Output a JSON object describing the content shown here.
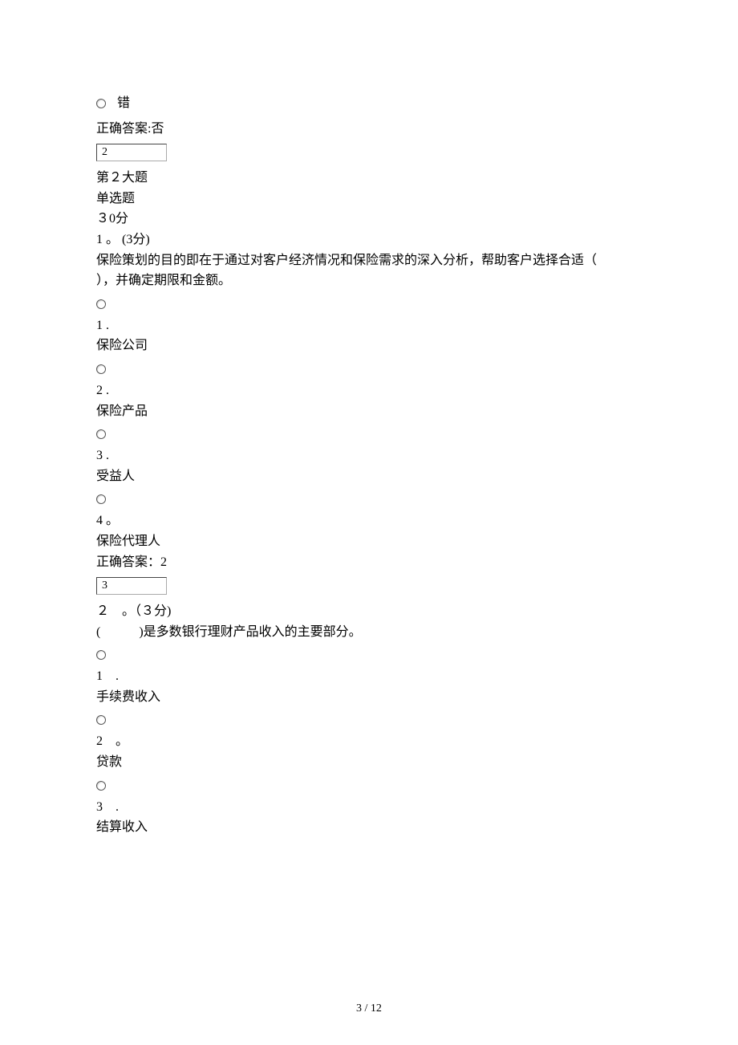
{
  "topRadio": {
    "label": "错"
  },
  "topAnswer": "正确答案:否",
  "box1": "2",
  "section2": {
    "header": {
      "l1": "第２大题",
      "l2": "单选题",
      "l3": "３0分"
    },
    "q1": {
      "lead": "1 。 (3分)",
      "text1": "保险策划的目的即在于通过对客户经济情况和保险需求的深入分析，帮助客户选择合适（",
      "text2": "），并确定期限和金额。",
      "opts": [
        {
          "num": "1 .",
          "text": "保险公司"
        },
        {
          "num": "2 .",
          "text": "保险产品"
        },
        {
          "num": "3 .",
          "text": "受益人"
        },
        {
          "num": "4 。",
          "text": "保险代理人"
        }
      ],
      "answer": "正确答案：2"
    },
    "box2": "3",
    "q2": {
      "lead": "２　。（３分)",
      "text1": "(　　　)是多数银行理财产品收入的主要部分。",
      "opts": [
        {
          "num": "1　.",
          "text": "手续费收入"
        },
        {
          "num": "2　。",
          "text": "贷款"
        },
        {
          "num": "3　.",
          "text": "结算收入"
        }
      ]
    }
  },
  "footer": "3 / 12"
}
